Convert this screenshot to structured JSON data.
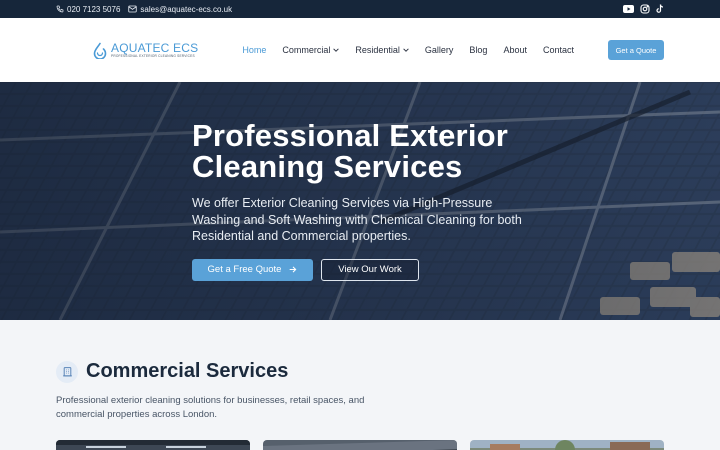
{
  "topbar": {
    "phone": "020 7123 5076",
    "email": "sales@aquatec-ecs.co.uk",
    "socials": [
      "youtube-icon",
      "instagram-icon",
      "tiktok-icon"
    ]
  },
  "brand": {
    "name": "AQUATEC ECS",
    "tagline": "PROFESSIONAL EXTERIOR CLEANING SERVICES",
    "accent": "#4a9ad6"
  },
  "nav": {
    "items": [
      {
        "label": "Home",
        "active": true,
        "dropdown": false
      },
      {
        "label": "Commercial",
        "active": false,
        "dropdown": true
      },
      {
        "label": "Residential",
        "active": false,
        "dropdown": true
      },
      {
        "label": "Gallery",
        "active": false,
        "dropdown": false
      },
      {
        "label": "Blog",
        "active": false,
        "dropdown": false
      },
      {
        "label": "About",
        "active": false,
        "dropdown": false
      },
      {
        "label": "Contact",
        "active": false,
        "dropdown": false
      }
    ],
    "cta": "Get a Quote"
  },
  "hero": {
    "title_line1": "Professional Exterior",
    "title_line2": "Cleaning Services",
    "description": "We offer Exterior Cleaning Services via High-Pressure Washing and Soft Washing with Chemical Cleaning for both Residential and Commercial properties.",
    "primary_button": "Get a Free Quote",
    "secondary_button": "View Our Work"
  },
  "commercial": {
    "title": "Commercial Services",
    "description": "Professional exterior cleaning solutions for businesses, retail spaces, and commercial properties across London."
  }
}
